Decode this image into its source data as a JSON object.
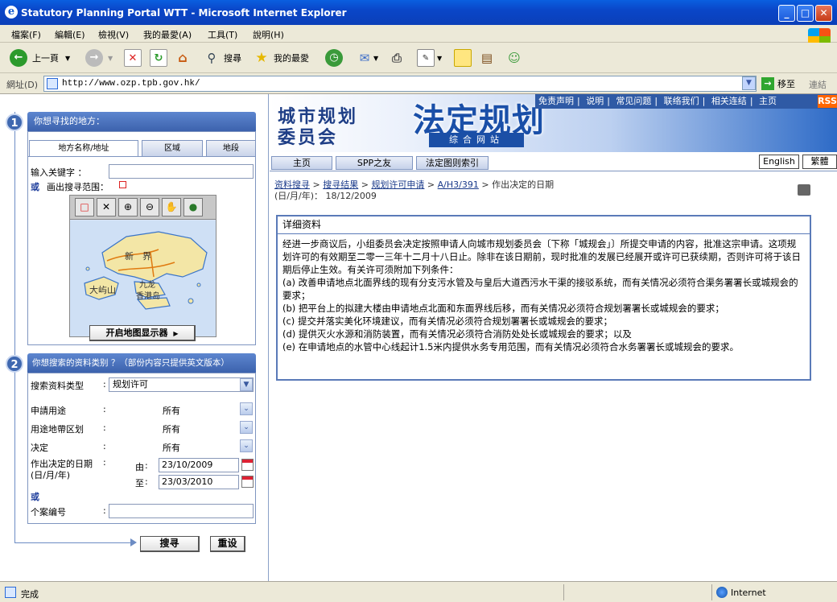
{
  "window": {
    "title": "Statutory Planning Portal WTT - Microsoft Internet Explorer",
    "min": "_",
    "max": "□",
    "close": "✕"
  },
  "menu": [
    "檔案(F)",
    "編輯(E)",
    "檢視(V)",
    "我的最愛(A)",
    "工具(T)",
    "說明(H)"
  ],
  "toolbar": {
    "back": "上一頁",
    "search": "搜尋",
    "favorites": "我的最愛"
  },
  "address": {
    "label": "網址(D)",
    "url": "http://www.ozp.tpb.gov.hk/",
    "go": "移至",
    "links": "連結"
  },
  "status": {
    "text": "完成",
    "zone": "Internet"
  },
  "left": {
    "step1": {
      "num": "1",
      "title": "你想寻找的地方："
    },
    "tabs": [
      "地方名称/地址",
      "区域",
      "地段"
    ],
    "keyword_label": "输入关键字 ：",
    "or1": "或",
    "draw_label": "画出搜寻范围：",
    "map_labels": {
      "new_territories": "新　界",
      "lantau": "大屿山",
      "kowloon": "九龙",
      "hk_island": "香港岛"
    },
    "open_map": "开启地图显示器",
    "step2": {
      "num": "2",
      "title": "你想搜索的资料类别 ？（部份内容只提供英文版本）"
    },
    "type_label": "搜索资料类型",
    "type_value": "规划许可",
    "colon": ":",
    "fields": [
      {
        "label": "申請用途",
        "value": "所有"
      },
      {
        "label": "用途地帶区划",
        "value": "所有"
      },
      {
        "label": "决定",
        "value": "所有"
      }
    ],
    "date_label1": "作出决定的日期",
    "date_label2": "(日/月/年)",
    "from_label": "由",
    "to_label": "至",
    "from_value": "23/10/2009",
    "to_value": "23/03/2010",
    "or2": "或",
    "case_label": "个案编号",
    "search_btn": "搜寻",
    "reset_btn": "重设"
  },
  "right": {
    "topnav": [
      "免责声明",
      "说明",
      "常见问题",
      "联络我们",
      "相关连结",
      "主页"
    ],
    "rss": "RSS",
    "banner": {
      "t1a": "城市规划",
      "t1b": "委员会",
      "t2": "法定规划",
      "t3": "综合网站"
    },
    "nav": [
      "主页",
      "SPP之友",
      "法定图则索引"
    ],
    "lang": [
      "English",
      "繁體"
    ],
    "crumb": {
      "c1": "资料搜寻",
      "c2": "搜寻结果",
      "c3": "规划许可申请",
      "c4": "A/H3/391",
      "c5": "作出决定的日期",
      "c6": "(日/月/年)： 18/12/2009"
    },
    "detail_title": "详细资料",
    "detail_lines": [
      "经进一步商议后，小组委员会决定按照申请人向城市规划委员会〔下称「城规会」〕所提交申请的内容，批准这宗申请。这项规划许可的有效期至二零一三年十二月十八日止。除非在该日期前，现时批准的发展已经展开或许可已获续期，否则许可将于该日期后停止生效。有关许可须附加下列条件：",
      "(a) 改善申请地点北面界线的现有分支污水管及与皇后大道西污水干渠的接驳系统，而有关情况必须符合渠务署署长或城规会的要求；",
      "(b) 把平台上的拟建大楼由申请地点北面和东面界线后移，而有关情况必须符合规划署署长或城规会的要求；",
      "(c) 提交并落实美化环境建议，而有关情况必须符合规划署署长或城规会的要求；",
      "(d) 提供灭火水源和消防装置，而有关情况必须符合消防处处长或城规会的要求；以及",
      "(e) 在申请地点的水管中心线起计1.5米内提供水务专用范围，而有关情况必须符合水务署署长或城规会的要求。"
    ]
  },
  "colors": {
    "accent": "#3c62ad",
    "title_blue": "#0a46c8"
  }
}
